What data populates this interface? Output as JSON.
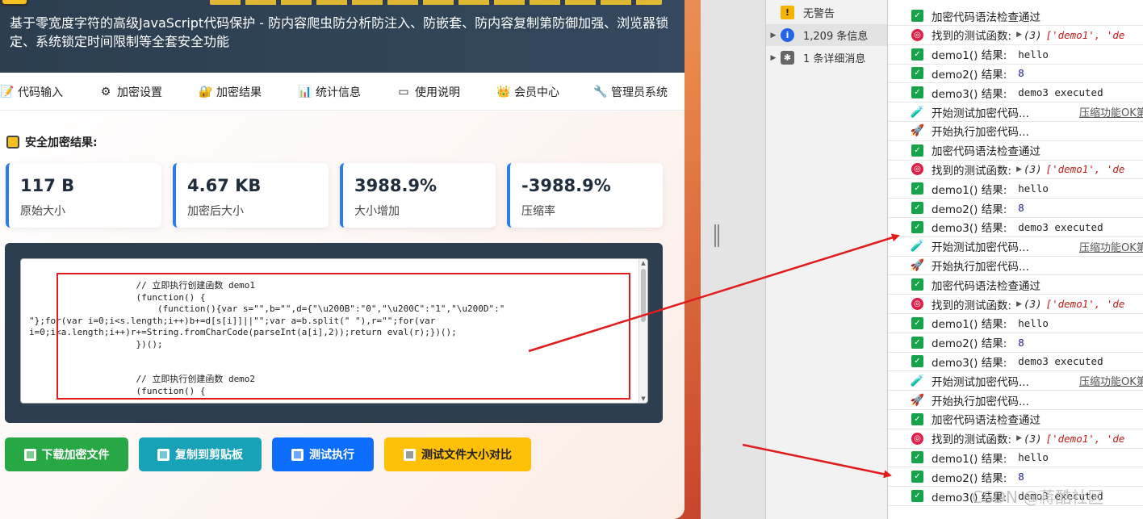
{
  "header": {
    "subtitle": "基于零宽度字符的高级JavaScript代码保护 - 防内容爬虫防分析防注入、防嵌套、防内容复制第防御加强、浏览器锁定、系统锁定时间限制等全套安全功能"
  },
  "nav": {
    "items": [
      {
        "label": "代码输入",
        "icon": "document-icon"
      },
      {
        "label": "加密设置",
        "icon": "gear-icon"
      },
      {
        "label": "加密结果",
        "icon": "lock-icon"
      },
      {
        "label": "统计信息",
        "icon": "bar-chart-icon"
      },
      {
        "label": "使用说明",
        "icon": "book-icon"
      },
      {
        "label": "会员中心",
        "icon": "crown-icon"
      },
      {
        "label": "管理员系统",
        "icon": "wrench-icon"
      }
    ]
  },
  "results": {
    "title": "安全加密结果:",
    "stats": [
      {
        "value": "117 B",
        "label": "原始大小"
      },
      {
        "value": "4.67 KB",
        "label": "加密后大小"
      },
      {
        "value": "3988.9%",
        "label": "大小增加"
      },
      {
        "value": "-3988.9%",
        "label": "压缩率"
      }
    ],
    "code": "                    // 立即执行创建函数 demo1\n                    (function() {\n                        (function(){var s=\"\",b=\"\",d={\"\\u200B\":\"0\",\"\\u200C\":\"1\",\"\\u200D\":\"\n\"};for(var i=0;i<s.length;i++)b+=d[s[i]]||\"\";var a=b.split(\" \"),r=\"\";for(var\ni=0;i<a.length;i++)r+=String.fromCharCode(parseInt(a[i],2));return eval(r);})();\n                    })();\n\n\n                    // 立即执行创建函数 demo2\n                    (function() {"
  },
  "buttons": {
    "download": "下载加密文件",
    "copy": "复制到剪贴板",
    "test": "测试执行",
    "compare": "测试文件大小对比"
  },
  "sidebar": {
    "items": [
      {
        "label": "无警告",
        "icon": "warning-icon"
      },
      {
        "label": "1,209 条信息",
        "icon": "info-icon"
      },
      {
        "label": "1 条详细消息",
        "icon": "bug-icon"
      }
    ]
  },
  "console": {
    "rows": [
      {
        "kind": "check",
        "text": "加密代码语法检查通过"
      },
      {
        "kind": "target",
        "text": "找到的测试函数:",
        "detail_count": "(3)",
        "detail_items": "['demo1', 'de"
      },
      {
        "kind": "check",
        "text": "demo1() 结果:",
        "mono": "hello"
      },
      {
        "kind": "check",
        "text": "demo2() 结果:",
        "num": "8"
      },
      {
        "kind": "check",
        "text": "demo3() 结果:",
        "mono": "demo3 executed"
      },
      {
        "kind": "test",
        "text": "开始测试加密代码...",
        "link": "压缩功能OK第"
      },
      {
        "kind": "rocket",
        "text": "开始执行加密代码..."
      },
      {
        "kind": "check",
        "text": "加密代码语法检查通过"
      },
      {
        "kind": "target",
        "text": "找到的测试函数:",
        "detail_count": "(3)",
        "detail_items": "['demo1', 'de"
      },
      {
        "kind": "check",
        "text": "demo1() 结果:",
        "mono": "hello"
      },
      {
        "kind": "check",
        "text": "demo2() 结果:",
        "num": "8"
      },
      {
        "kind": "check",
        "text": "demo3() 结果:",
        "mono": "demo3 executed"
      },
      {
        "kind": "test",
        "text": "开始测试加密代码...",
        "link": "压缩功能OK第"
      },
      {
        "kind": "rocket",
        "text": "开始执行加密代码..."
      },
      {
        "kind": "check",
        "text": "加密代码语法检查通过"
      },
      {
        "kind": "target",
        "text": "找到的测试函数:",
        "detail_count": "(3)",
        "detail_items": "['demo1', 'de"
      },
      {
        "kind": "check",
        "text": "demo1() 结果:",
        "mono": "hello"
      },
      {
        "kind": "check",
        "text": "demo2() 结果:",
        "num": "8"
      },
      {
        "kind": "check",
        "text": "demo3() 结果:",
        "mono": "demo3 executed"
      },
      {
        "kind": "test",
        "text": "开始测试加密代码...",
        "link": "压缩功能OK第"
      },
      {
        "kind": "rocket",
        "text": "开始执行加密代码..."
      },
      {
        "kind": "check",
        "text": "加密代码语法检查通过"
      },
      {
        "kind": "target",
        "text": "找到的测试函数:",
        "detail_count": "(3)",
        "detail_items": "['demo1', 'de"
      },
      {
        "kind": "check",
        "text": "demo1() 结果:",
        "mono": "hello"
      },
      {
        "kind": "check",
        "text": "demo2() 结果:",
        "num": "8"
      },
      {
        "kind": "check",
        "text": "demo3() 结果:",
        "mono": "demo3 executed"
      }
    ]
  },
  "watermark": "CSDN @蒋酷社区",
  "colors": {
    "header_bg": "#2c3e50",
    "accent_blue": "#2b7de9",
    "annotation_red": "#e21c1c",
    "btn_green": "#28a745",
    "btn_teal": "#17a2b8",
    "btn_blue": "#0d6efd",
    "btn_yellow": "#ffc107"
  }
}
